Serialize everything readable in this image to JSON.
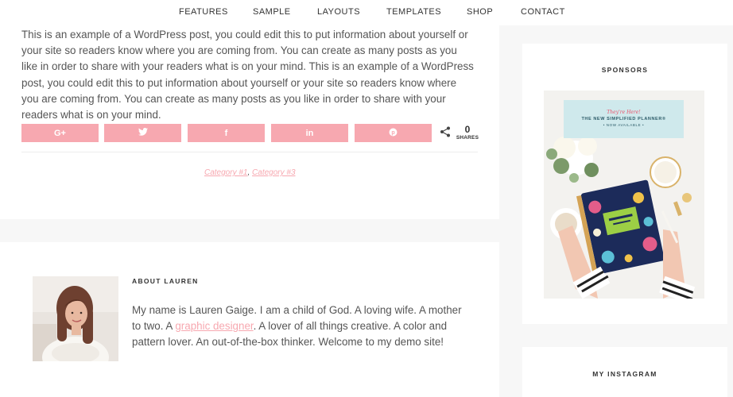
{
  "nav": {
    "items": [
      {
        "label": "FEATURES"
      },
      {
        "label": "SAMPLE"
      },
      {
        "label": "LAYOUTS"
      },
      {
        "label": "TEMPLATES"
      },
      {
        "label": "SHOP"
      },
      {
        "label": "CONTACT"
      }
    ]
  },
  "post": {
    "body": "This is an example of a WordPress post, you could edit this to put information about yourself or your site so readers know where you are coming from. You can create as many posts as you like in order to share with your readers what is on your mind. This is an example of a WordPress post, you could edit this to put information about yourself or your site so readers know where you are coming from. You can create as many posts as you like in order to share with your readers what is on your mind."
  },
  "share": {
    "buttons": [
      {
        "label": "G+",
        "icon": "google-plus-icon"
      },
      {
        "label": "t",
        "icon": "twitter-icon"
      },
      {
        "label": "f",
        "icon": "facebook-icon"
      },
      {
        "label": "in",
        "icon": "linkedin-icon"
      },
      {
        "label": "p",
        "icon": "pinterest-icon"
      }
    ],
    "count": "0",
    "count_label": "SHARES",
    "button_color": "#f7a8b0"
  },
  "categories": {
    "items": [
      "Category #1",
      "Category #3"
    ],
    "separator": ","
  },
  "about": {
    "title": "ABOUT LAUREN",
    "text_before": "My name is Lauren Gaige. I am a child of God. A loving wife. A mother to two. A ",
    "link": "graphic designer",
    "text_after": ". A lover of all things creative. A color and pattern lover. An out-of-the-box thinker. Welcome to my demo site!"
  },
  "sidebar": {
    "sponsors_title": "SPONSORS",
    "ad": {
      "script": "They're Here!",
      "headline": "THE NEW SIMPLIFIED PLANNER®",
      "sub": "• NOW AVAILABLE •"
    },
    "instagram_title": "MY INSTAGRAM"
  }
}
